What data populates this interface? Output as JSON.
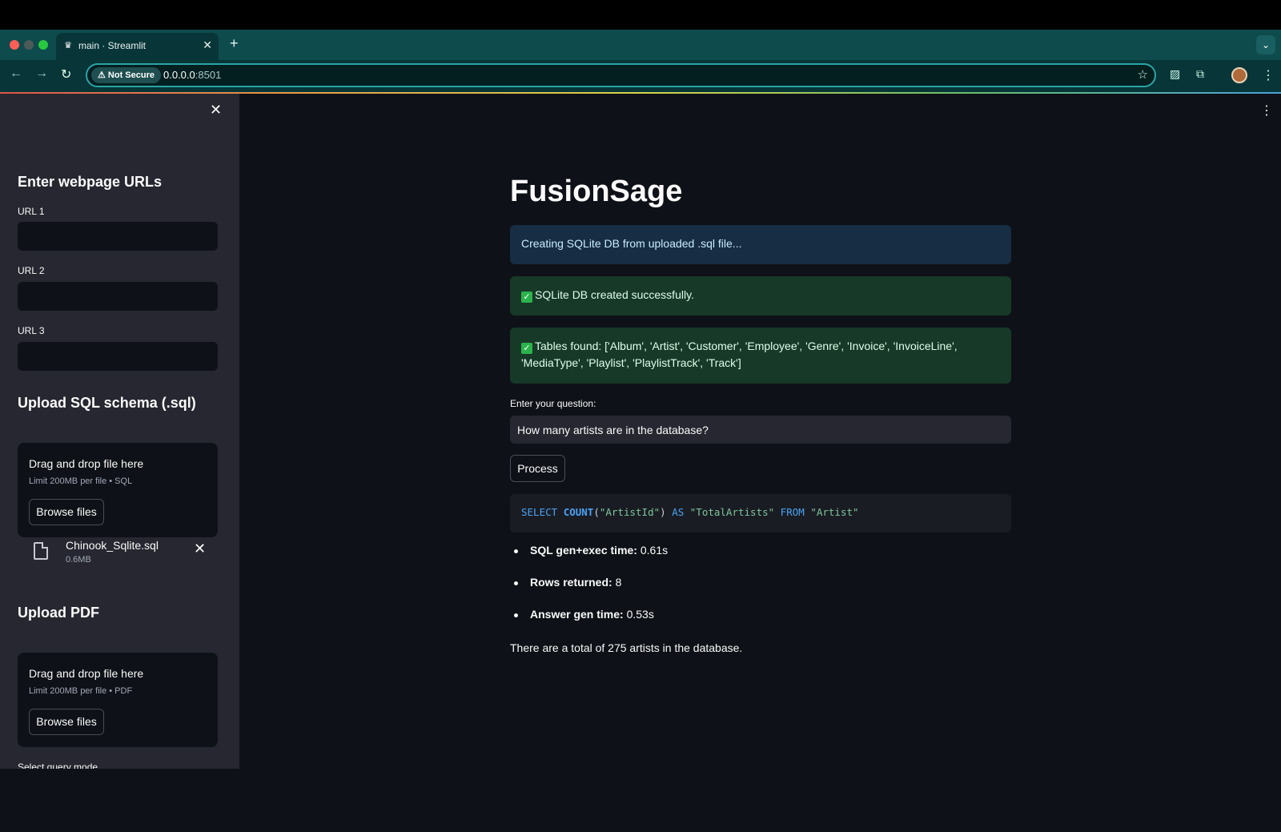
{
  "browser": {
    "tab_title": "main · Streamlit",
    "security_label": "Not Secure",
    "url_host": "0.0.0.0",
    "url_port": ":8501"
  },
  "sidebar": {
    "urls_heading": "Enter webpage URLs",
    "url_fields": [
      {
        "label": "URL 1",
        "value": ""
      },
      {
        "label": "URL 2",
        "value": ""
      },
      {
        "label": "URL 3",
        "value": ""
      }
    ],
    "sql_heading": "Upload SQL schema (.sql)",
    "sql_uploader": {
      "title": "Drag and drop file here",
      "limit": "Limit 200MB per file • SQL",
      "button": "Browse files"
    },
    "uploaded_file": {
      "name": "Chinook_Sqlite.sql",
      "size": "0.6MB"
    },
    "pdf_heading": "Upload PDF",
    "pdf_uploader": {
      "title": "Drag and drop file here",
      "limit": "Limit 200MB per file • PDF",
      "button": "Browse files"
    },
    "query_mode_label": "Select query mode"
  },
  "main": {
    "title": "FusionSage",
    "alerts": [
      {
        "type": "info",
        "text": "Creating SQLite DB from uploaded .sql file..."
      },
      {
        "type": "success",
        "text": "SQLite DB created successfully."
      },
      {
        "type": "success",
        "text": "Tables found: ['Album', 'Artist', 'Customer', 'Employee', 'Genre', 'Invoice', 'InvoiceLine', 'MediaType', 'Playlist', 'PlaylistTrack', 'Track']"
      }
    ],
    "question_label": "Enter your question:",
    "question_value": "How many artists are in the database?",
    "process_button": "Process",
    "sql": {
      "kw_select": "SELECT",
      "fn_count": "COUNT",
      "col": "\"ArtistId\"",
      "kw_as": "AS",
      "alias": "\"TotalArtists\"",
      "kw_from": "FROM",
      "table": "\"Artist\""
    },
    "stats": [
      {
        "label": "SQL gen+exec time:",
        "value": "0.61s"
      },
      {
        "label": "Rows returned:",
        "value": "8"
      },
      {
        "label": "Answer gen time:",
        "value": "0.53s"
      }
    ],
    "answer": "There are a total of 275 artists in the database."
  },
  "colors": {
    "app_bg": "#0e1117",
    "sidebar_bg": "#262730",
    "info_bg": "#172d43",
    "success_bg": "#173928",
    "browser_tabbar": "#0e4b4d"
  }
}
